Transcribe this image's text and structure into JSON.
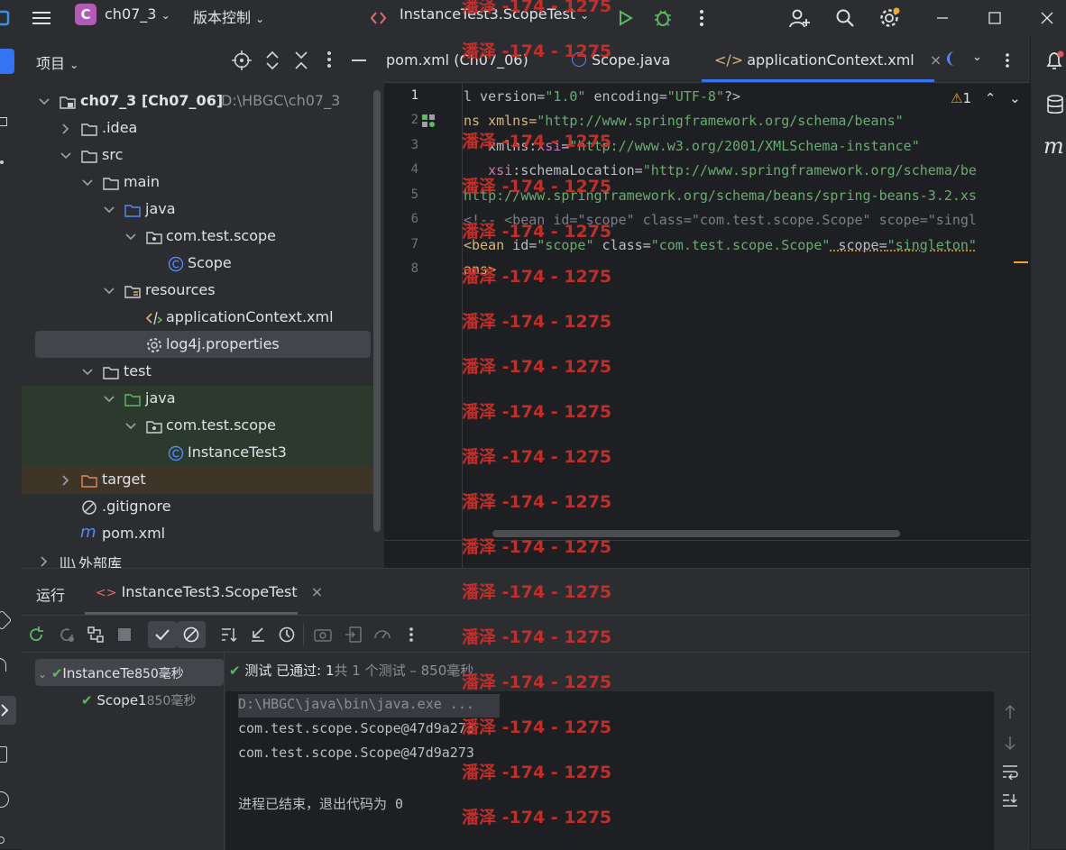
{
  "titlebar": {
    "project_badge": "C",
    "project_name": "ch07_3",
    "vcs_label": "版本控制",
    "run_config": "InstanceTest3.ScopeTest"
  },
  "project_panel": {
    "title": "项目",
    "tree": [
      {
        "name": "ch07_3 [Ch07_06]",
        "hint": "D:\\HBGC\\ch07_3"
      },
      {
        "name": ".idea"
      },
      {
        "name": "src"
      },
      {
        "name": "main"
      },
      {
        "name": "java"
      },
      {
        "name": "com.test.scope"
      },
      {
        "name": "Scope"
      },
      {
        "name": "resources"
      },
      {
        "name": "applicationContext.xml"
      },
      {
        "name": "log4j.properties"
      },
      {
        "name": "test"
      },
      {
        "name": "java"
      },
      {
        "name": "com.test.scope"
      },
      {
        "name": "InstanceTest3"
      },
      {
        "name": "target"
      },
      {
        "name": ".gitignore"
      },
      {
        "name": "pom.xml"
      },
      {
        "name": "外部库"
      }
    ]
  },
  "editor": {
    "tabs": [
      {
        "label": "pom.xml (Ch07_06)"
      },
      {
        "label": "Scope.java"
      },
      {
        "label": "applicationContext.xml"
      }
    ],
    "warning_count": "1",
    "line_numbers": [
      "1",
      "2",
      "3",
      "4",
      "5",
      "6",
      "7",
      "8"
    ],
    "code": {
      "l1": {
        "a": "l version=",
        "b": "\"1.0\"",
        "c": " encoding=",
        "d": "\"UTF-8\"",
        "e": "?>"
      },
      "l2": {
        "a": "ns xmlns=",
        "b": "\"http://www.springframework.org/schema/beans\""
      },
      "l3": {
        "a": "   xmlns:",
        "b": "xsi",
        "c": "=",
        "d": "\"http://www.w3.org/2001/XMLSchema-instance\""
      },
      "l4": {
        "a": "   ",
        "b": "xsi",
        "c": ":schemaLocation=",
        "d": "\"http://www.springframework.org/schema/be"
      },
      "l5": {
        "a": "http://www.springframework.org/schema/beans/spring-beans-3.2.xs"
      },
      "l6": {
        "a": "<!-- <bean id=\"scope\" class=\"com.test.scope.Scope\" scope=\"singl"
      },
      "l7": {
        "a": "<bean",
        "b": " id=",
        "c": "\"scope\"",
        "d": " class=",
        "e": "\"com.test.scope.Scope\"",
        "f": " scope=",
        "g": "\"singleton\""
      },
      "l8": {
        "a": "ans>"
      }
    }
  },
  "run_panel": {
    "title": "运行",
    "tab_label": "InstanceTest3.ScopeTest",
    "tests": [
      {
        "name": "InstanceTe",
        "time": "850毫秒"
      },
      {
        "name": "Scope1",
        "time": "850毫秒"
      }
    ],
    "status_passed": "测试 已通过: 1",
    "status_summary": "共 1 个测试 – 850毫秒",
    "console": [
      "D:\\HBGC\\java\\bin\\java.exe ...",
      "com.test.scope.Scope@47d9a273",
      "com.test.scope.Scope@47d9a273",
      "",
      "进程已结束，退出代码为 0"
    ]
  },
  "watermark": "潘泽 -174 - 1275",
  "colors": {
    "accent": "#3574f0",
    "success": "#5fb865",
    "watermark": "#c8302b"
  }
}
